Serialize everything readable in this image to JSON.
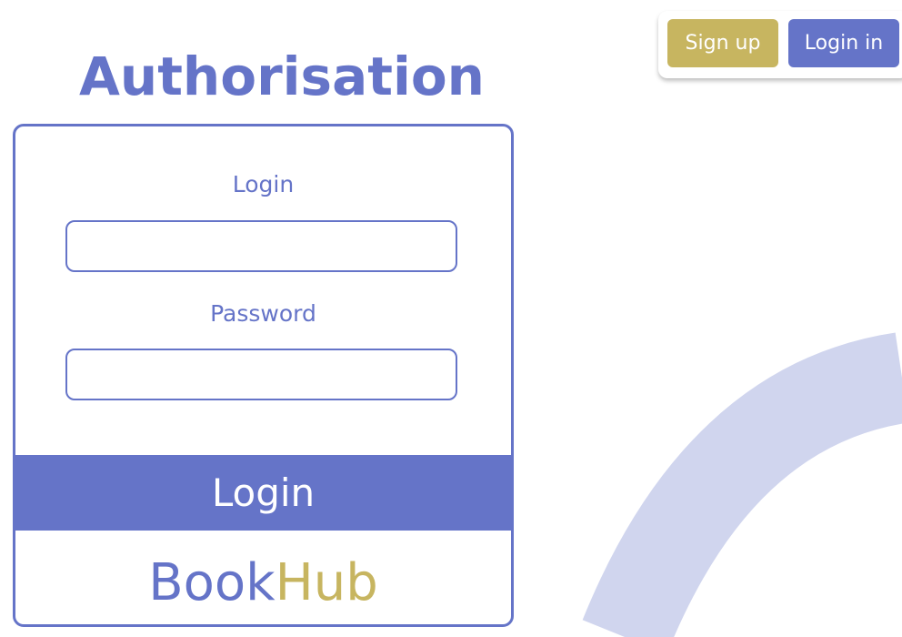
{
  "header": {
    "signup_label": "Sign up",
    "login_label": "Login in"
  },
  "page": {
    "title": "Authorisation"
  },
  "form": {
    "login_label": "Login",
    "login_value": "",
    "password_label": "Password",
    "password_value": "",
    "submit_label": "Login"
  },
  "brand": {
    "part1": "Book",
    "part2": "Hub"
  },
  "colors": {
    "primary": "#6574c8",
    "accent": "#c7b560",
    "decoration": "#d0d5ee",
    "background": "#ffffff"
  }
}
